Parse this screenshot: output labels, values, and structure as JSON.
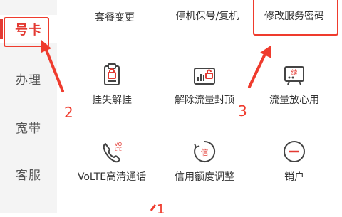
{
  "sidebar": {
    "items": [
      {
        "label": "号卡",
        "active": true
      },
      {
        "label": "办理",
        "active": false
      },
      {
        "label": "宽带",
        "active": false
      },
      {
        "label": "客服",
        "active": false
      }
    ]
  },
  "grid": {
    "items": [
      {
        "label": "套餐变更",
        "icon": "package-change-icon"
      },
      {
        "label": "停机保号/复机",
        "icon": "suspend-number-icon"
      },
      {
        "label": "修改服务密码",
        "icon": "change-password-icon"
      },
      {
        "label": "挂失解挂",
        "icon": "report-loss-icon"
      },
      {
        "label": "解除流量封顶",
        "icon": "unlock-data-cap-icon"
      },
      {
        "label": "流量放心用",
        "icon": "data-worry-free-icon"
      },
      {
        "label": "VoLTE高清通话",
        "icon": "volte-phone-icon"
      },
      {
        "label": "信用额度调整",
        "icon": "credit-limit-icon"
      },
      {
        "label": "销户",
        "icon": "cancel-account-icon"
      }
    ],
    "icon_badges": {
      "volte_line1": "VO",
      "volte_line2": "LTE",
      "credit": "信",
      "data_free": "续"
    }
  },
  "annotations": {
    "step1": "1",
    "step2": "2",
    "step3": "3"
  },
  "colors": {
    "accent": "#e33a33",
    "annotation": "#ef3b2d",
    "icon": "#444444"
  }
}
